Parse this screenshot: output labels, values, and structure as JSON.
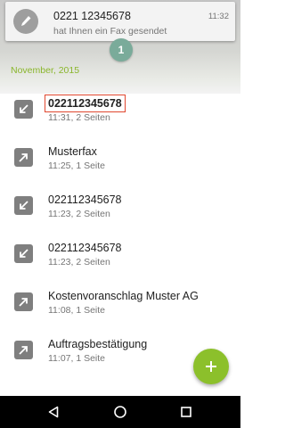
{
  "notification": {
    "title": "0221 12345678",
    "text": "hat Ihnen ein Fax gesendet",
    "time": "11:32",
    "icon": "fax-pen-icon"
  },
  "badge": {
    "count": "1"
  },
  "section": {
    "header": "November, 2015"
  },
  "list": {
    "items": [
      {
        "title": "022112345678",
        "subtitle": "11:31, 2 Seiten",
        "direction": "incoming",
        "highlighted": true
      },
      {
        "title": "Musterfax",
        "subtitle": "11:25, 1 Seite",
        "direction": "outgoing",
        "highlighted": false
      },
      {
        "title": "022112345678",
        "subtitle": "11:23, 2 Seiten",
        "direction": "incoming",
        "highlighted": false
      },
      {
        "title": "022112345678",
        "subtitle": "11:23, 2 Seiten",
        "direction": "incoming",
        "highlighted": false
      },
      {
        "title": "Kostenvoranschlag Muster AG",
        "subtitle": "11:08, 1 Seite",
        "direction": "outgoing",
        "highlighted": false
      },
      {
        "title": "Auftragsbestätigung",
        "subtitle": "11:07, 1 Seite",
        "direction": "outgoing",
        "highlighted": false
      }
    ]
  },
  "fab": {
    "icon": "plus-icon"
  },
  "navbar": {
    "icons": [
      "back-icon",
      "home-icon",
      "recents-icon"
    ]
  },
  "colors": {
    "accent": "#8cc02b",
    "badge": "#7aab9a",
    "highlight_border": "#e0472f",
    "icon_gray": "#7f7f7f"
  }
}
